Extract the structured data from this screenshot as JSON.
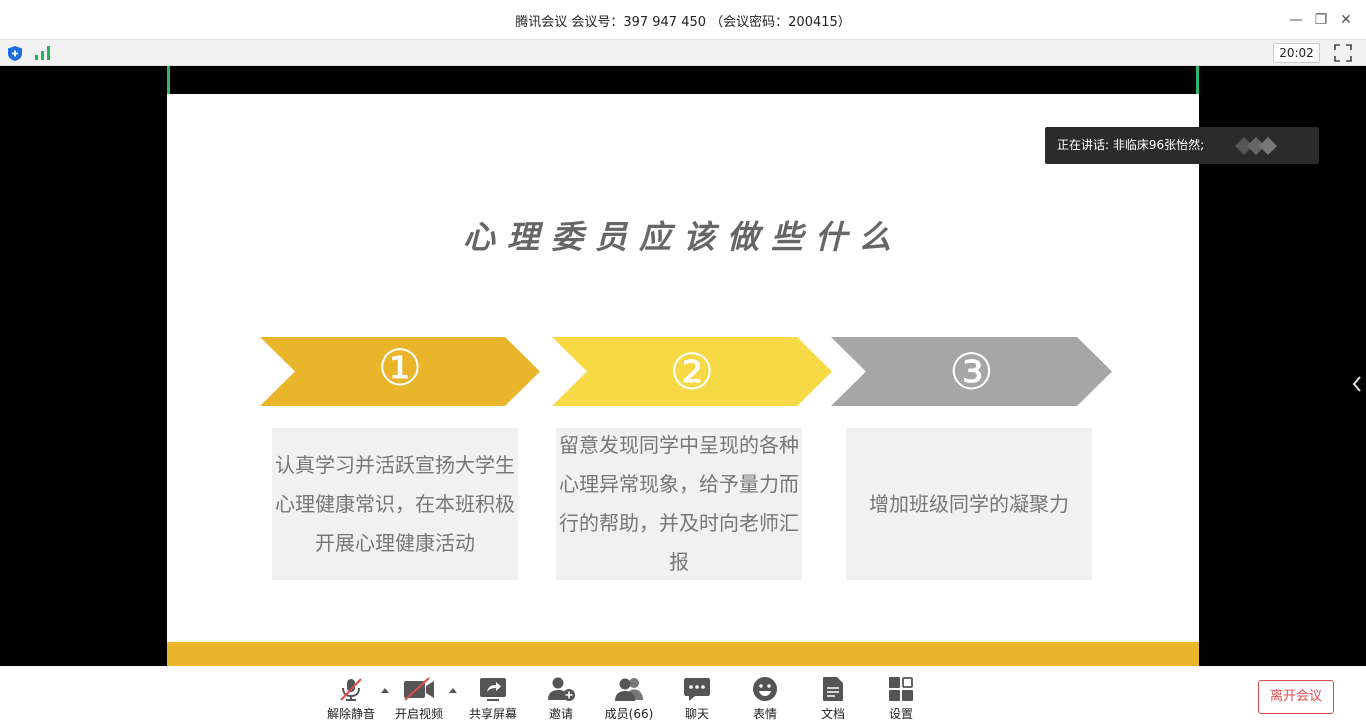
{
  "window": {
    "title": "腾讯会议 会议号：397 947 450 （会议密码：200415）",
    "minimize": "—",
    "restore": "❐",
    "close": "✕"
  },
  "infobar": {
    "timer": "20:02"
  },
  "slide": {
    "title": "心理委员应该做些什么",
    "steps": [
      {
        "num": "①",
        "color": "#e9b52a",
        "text": "认真学习并活跃宣扬大学生心理健康常识，在本班积极开展心理健康活动"
      },
      {
        "num": "②",
        "color": "#f7d945",
        "text": "留意发现同学中呈现的各种心理异常现象，给予量力而行的帮助，并及时向老师汇报"
      },
      {
        "num": "③",
        "color": "#a6a6a6",
        "text": "增加班级同学的凝聚力"
      }
    ],
    "footer_color": "#e9b52a"
  },
  "speaking": {
    "text": "正在讲话: 非临床96张怡然;"
  },
  "toolbar": {
    "mute": "解除静音",
    "video": "开启视频",
    "share": "共享屏幕",
    "invite": "邀请",
    "members": "成员(66)",
    "chat": "聊天",
    "emoji": "表情",
    "docs": "文档",
    "settings": "设置",
    "leave": "离开会议"
  }
}
